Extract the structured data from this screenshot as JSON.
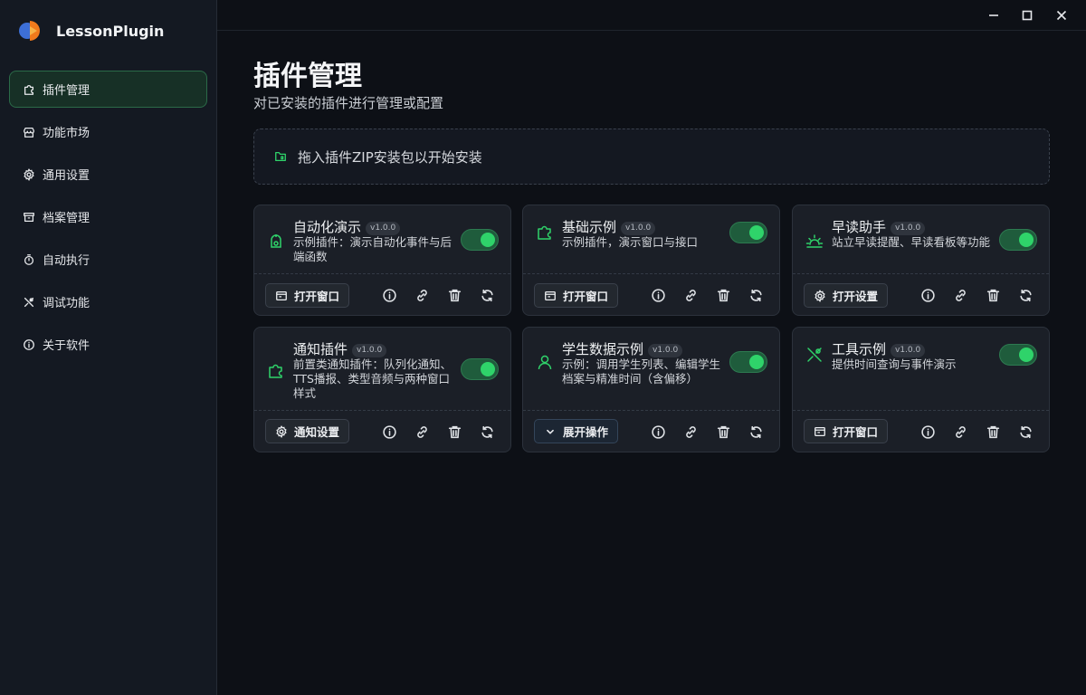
{
  "app": {
    "name": "LessonPlugin"
  },
  "sidebar": {
    "items": [
      {
        "label": "插件管理",
        "icon": "puzzle-icon",
        "active": true
      },
      {
        "label": "功能市场",
        "icon": "store-icon",
        "active": false
      },
      {
        "label": "通用设置",
        "icon": "gear-icon",
        "active": false
      },
      {
        "label": "档案管理",
        "icon": "archive-icon",
        "active": false
      },
      {
        "label": "自动执行",
        "icon": "timer-icon",
        "active": false
      },
      {
        "label": "调试功能",
        "icon": "tools-icon",
        "active": false
      },
      {
        "label": "关于软件",
        "icon": "info-icon",
        "active": false
      }
    ]
  },
  "page": {
    "title": "插件管理",
    "subtitle": "对已安装的插件进行管理或配置",
    "dropzone": "拖入插件ZIP安装包以开始安装"
  },
  "cards": [
    {
      "name": "自动化演示",
      "version": "v1.0.0",
      "desc": "示例插件：演示自动化事件与后端函数",
      "enabled": true,
      "icon": "robot-icon",
      "button": "打开窗口",
      "button_icon": "window-icon"
    },
    {
      "name": "基础示例",
      "version": "v1.0.0",
      "desc": "示例插件，演示窗口与接口",
      "enabled": true,
      "icon": "puzzle-icon",
      "button": "打开窗口",
      "button_icon": "window-icon"
    },
    {
      "name": "早读助手",
      "version": "v1.0.0",
      "desc": "站立早读提醒、早读看板等功能",
      "enabled": true,
      "icon": "sunrise-icon",
      "button": "打开设置",
      "button_icon": "gear-icon"
    },
    {
      "name": "通知插件",
      "version": "v1.0.0",
      "desc": "前置类通知插件：队列化通知、TTS播报、类型音频与两种窗口样式",
      "enabled": true,
      "icon": "puzzle-icon",
      "button": "通知设置",
      "button_icon": "gear-icon"
    },
    {
      "name": "学生数据示例",
      "version": "v1.0.0",
      "desc": "示例：调用学生列表、编辑学生档案与精准时间（含偏移）",
      "enabled": true,
      "icon": "user-icon",
      "button": "展开操作",
      "button_icon": "chevron-down-icon"
    },
    {
      "name": "工具示例",
      "version": "v1.0.0",
      "desc": "提供时间查询与事件演示",
      "enabled": true,
      "icon": "tools-icon",
      "button": "打开窗口",
      "button_icon": "window-icon"
    }
  ],
  "colors": {
    "accent": "#2fd36a",
    "active_nav_bg": "#173026",
    "card_bg": "#1b1f27",
    "background": "#0d1016"
  }
}
